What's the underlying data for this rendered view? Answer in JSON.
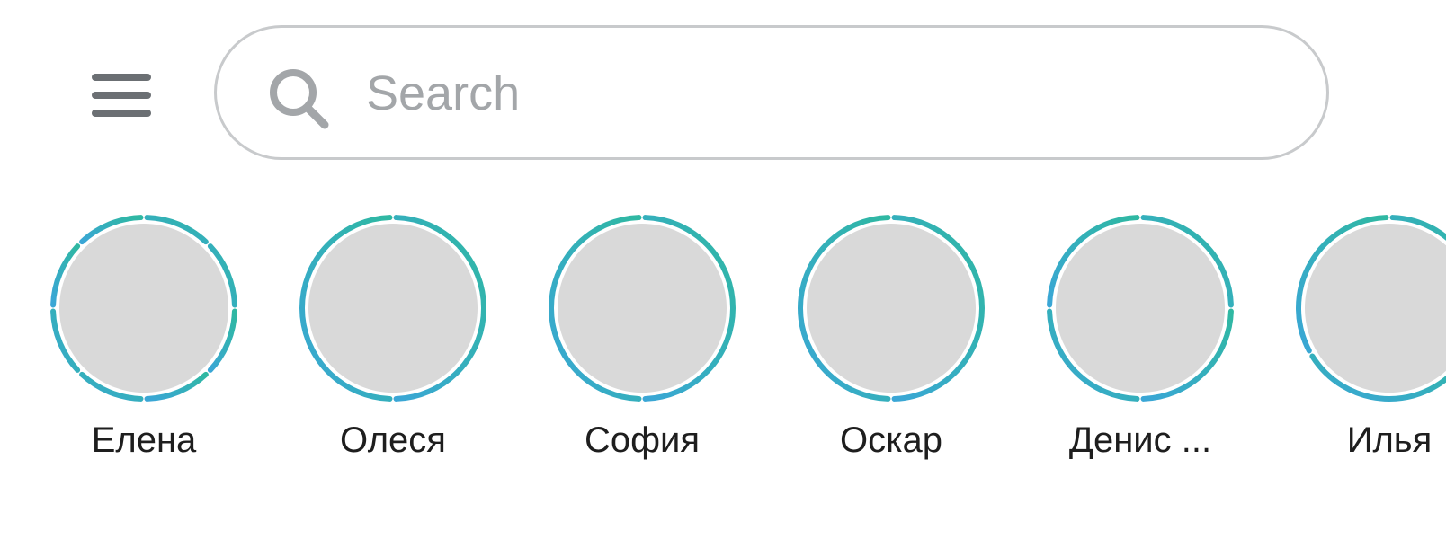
{
  "menu": {
    "icon": "hamburger-menu-icon"
  },
  "search": {
    "placeholder": "Search",
    "value": "",
    "icon": "search-icon"
  },
  "colors": {
    "ring_start": "#2fb8a2",
    "ring_end": "#3aa6d6",
    "avatar_placeholder": "#d9d9d9",
    "search_border": "#c8cacc",
    "menu_icon": "#6b6f73",
    "search_icon": "#a3a6a9"
  },
  "stories": [
    {
      "name": "Елена",
      "segments": 8
    },
    {
      "name": "Олеся",
      "segments": 2
    },
    {
      "name": "София",
      "segments": 2
    },
    {
      "name": "Оскар",
      "segments": 2
    },
    {
      "name": "Денис ...",
      "segments": 4
    },
    {
      "name": "Илья",
      "segments": 3
    }
  ]
}
